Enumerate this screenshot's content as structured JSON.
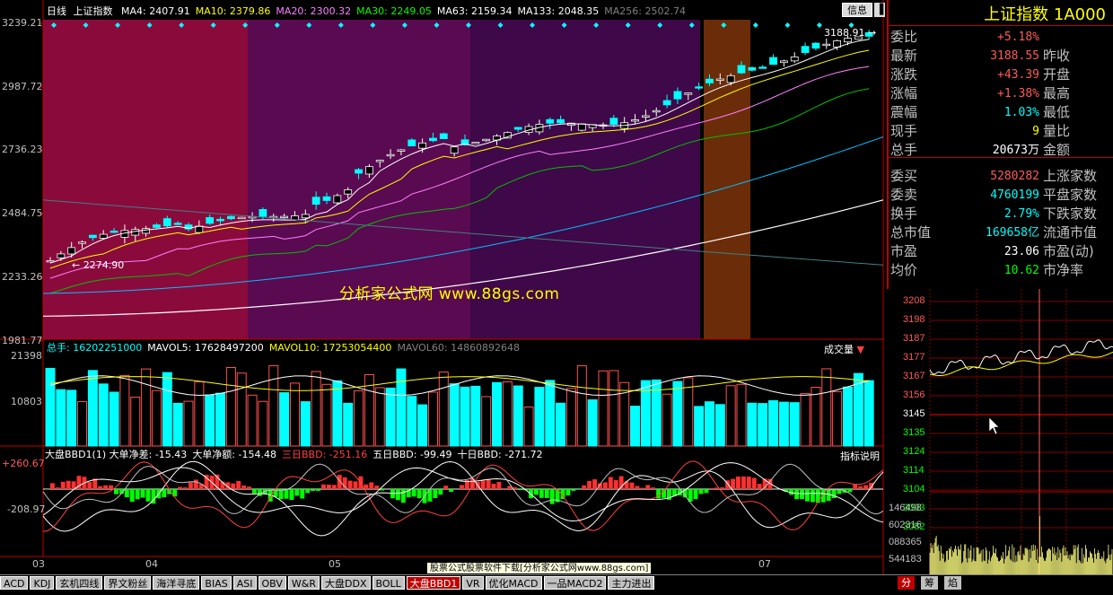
{
  "chart_header": {
    "period": "日线",
    "name": "上证指数",
    "ma": [
      {
        "label": "MA4: 2407.91",
        "color": "#ffffff"
      },
      {
        "label": "MA10: 2379.86",
        "color": "#ffff00"
      },
      {
        "label": "MA20: 2300.32",
        "color": "#ff80ff"
      },
      {
        "label": "MA30: 2249.05",
        "color": "#00ff00"
      },
      {
        "label": "MA63: 2159.34",
        "color": "#ffffff"
      },
      {
        "label": "MA133: 2048.35",
        "color": "#ffffff"
      },
      {
        "label": "MA256: 2502.74",
        "color": "#808080"
      }
    ]
  },
  "buttons": {
    "info": "信息",
    "close": "▐"
  },
  "price_axis": [
    "3239.21",
    "2987.72",
    "2736.23",
    "2484.75",
    "2233.26",
    "1981.77"
  ],
  "annotations": {
    "high": "3188.91",
    "low": "2274.90"
  },
  "watermark": "分析家公式网 www.88gs.com",
  "volume_header": {
    "items": [
      {
        "label": "总手: 16202251000",
        "color": "#00ffff"
      },
      {
        "label": "MAVOL5: 17628497200",
        "color": "#ffffff"
      },
      {
        "label": "MAVOL10: 17253054400",
        "color": "#ffff00"
      },
      {
        "label": "MAVOL60: 14860892648",
        "color": "#808080"
      }
    ],
    "tag": "成交量"
  },
  "volume_axis": [
    "21398",
    "10803"
  ],
  "bbd_header": {
    "items": [
      {
        "label": "大盘BBD1(1) 大单净差: -15.43",
        "color": "#ffffff"
      },
      {
        "label": "大单净额: -154.48",
        "color": "#ffffff"
      },
      {
        "label": "三日BBD: -251.16",
        "color": "#ff4040"
      },
      {
        "label": "五日BBD: -99.49",
        "color": "#ffffff"
      },
      {
        "label": "十日BBD: -271.72",
        "color": "#ffffff"
      }
    ],
    "button": "指标说明"
  },
  "bbd_axis": [
    "+260.67",
    "-208.97"
  ],
  "x_axis": [
    "03",
    "04",
    "05",
    "07"
  ],
  "right_panel": {
    "title": "上证指数 1A000",
    "rows": [
      {
        "label": "委比",
        "value": "+5.18%",
        "color": "#ff5a5a",
        "label2": ""
      },
      {
        "label": "最新",
        "value": "3188.55",
        "color": "#ff5a5a",
        "label2": "昨收"
      },
      {
        "label": "涨跌",
        "value": "+43.39",
        "color": "#ff5a5a",
        "label2": "开盘"
      },
      {
        "label": "涨幅",
        "value": "+1.38%",
        "color": "#ff5a5a",
        "label2": "最高"
      },
      {
        "label": "震幅",
        "value": "1.03%",
        "color": "#00ffff",
        "label2": "最低"
      },
      {
        "label": "现手",
        "value": "9",
        "color": "#ffff00",
        "label2": "量比"
      },
      {
        "label": "总手",
        "value": "20673万",
        "color": "#ffffff",
        "label2": "金额"
      },
      {
        "label": "委买",
        "value": "5280282",
        "color": "#ff5a5a",
        "label2": "上涨家数"
      },
      {
        "label": "委卖",
        "value": "4760199",
        "color": "#00ffff",
        "label2": "平盘家数"
      },
      {
        "label": "换手",
        "value": "2.79%",
        "color": "#00ffff",
        "label2": "下跌家数"
      },
      {
        "label": "总市值",
        "value": "169658亿",
        "color": "#00ffff",
        "label2": "流通市值"
      },
      {
        "label": "市盈",
        "value": "23.06",
        "color": "#ffffff",
        "label2": "市盈(动)"
      },
      {
        "label": "均价",
        "value": "10.62",
        "color": "#00ff00",
        "label2": "市净率"
      }
    ]
  },
  "mini_chart": {
    "price_axis": [
      "3208",
      "3198",
      "3187",
      "3177",
      "3167",
      "3156",
      "3145",
      "3135",
      "3124",
      "3114",
      "3104",
      "3093",
      "3082"
    ],
    "volume_axis": [
      "146498",
      "602316",
      "088365",
      "544183"
    ]
  },
  "bottom_tabs": [
    "ACD",
    "KDJ",
    "玄机四线",
    "界文粉丝",
    "海洋寻底",
    "BIAS",
    "ASI",
    "OBV",
    "W&R",
    "大盘DDX",
    "BOLL",
    "大盘BBD1",
    "VR",
    "优化MACD",
    "一品MACD2",
    "主力进出"
  ],
  "active_tab": "大盘BBD1",
  "right_tabs": [
    "分",
    "筹",
    "焰"
  ],
  "download_banner": "股票公式股票软件下载[分析家公式网www.88gs.com]",
  "colors": {
    "up": "#ff5050",
    "down": "#00ffff",
    "bg": "#000000",
    "grid": "#c00000"
  }
}
